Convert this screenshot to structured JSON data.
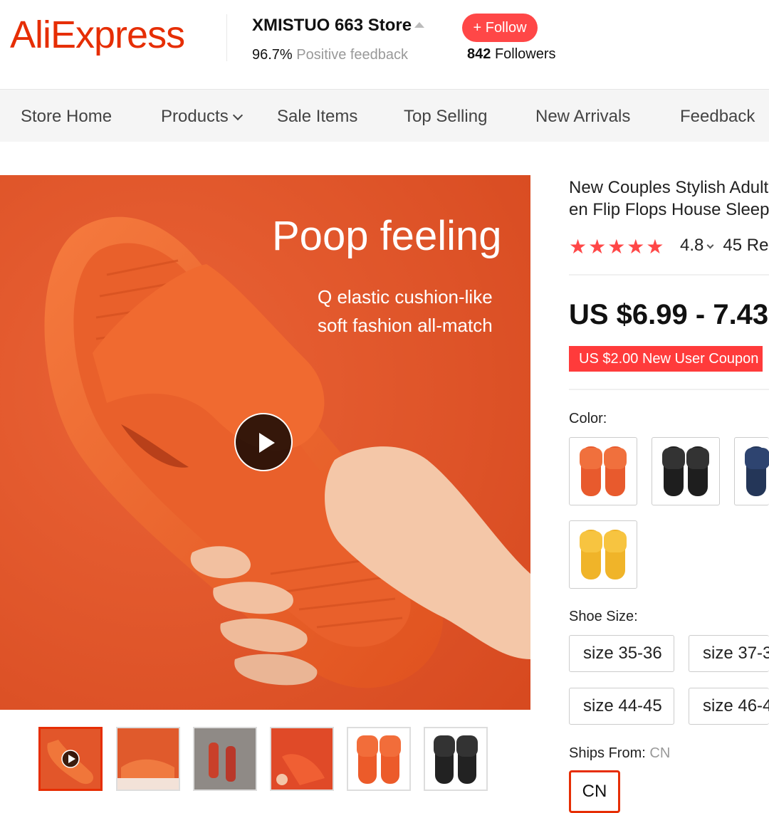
{
  "header": {
    "logo": "AliExpress",
    "store_name": "XMISTUO 663 Store",
    "positive_pct": "96.7%",
    "positive_label": "Positive feedback",
    "follow_label": "+ Follow",
    "followers_count": "842",
    "followers_label": "Followers"
  },
  "nav": {
    "items": [
      "Store Home",
      "Products",
      "Sale Items",
      "Top Selling",
      "New Arrivals",
      "Feedback"
    ]
  },
  "gallery": {
    "title": "Poop feeling",
    "sub1": "Q elastic cushion-like",
    "sub2": "soft fashion all-match",
    "thumb_count": 6,
    "selected_thumb": 0
  },
  "product": {
    "title_line1": "New Couples Stylish Adult",
    "title_line2": "en Flip Flops House Sleepe",
    "stars": "★★★★★",
    "rating": "4.8",
    "reviews": "45 Re",
    "price": "US $6.99 - 7.43",
    "coupon": "US $2.00 New User Coupon",
    "color_label": "Color:",
    "colors": [
      "orange",
      "black",
      "navy",
      "yellow"
    ],
    "size_label": "Shoe Size:",
    "sizes": [
      "size 35-36",
      "size 37-3",
      "size 44-45",
      "size 46-4"
    ],
    "ships_label": "Ships From:",
    "ships_value": "CN",
    "ships_option": "CN"
  },
  "colors": {
    "brand": "#e62e04",
    "follow": "#ff4747",
    "star": "#ff4747",
    "coupon_bg": "#ff3b3b"
  }
}
